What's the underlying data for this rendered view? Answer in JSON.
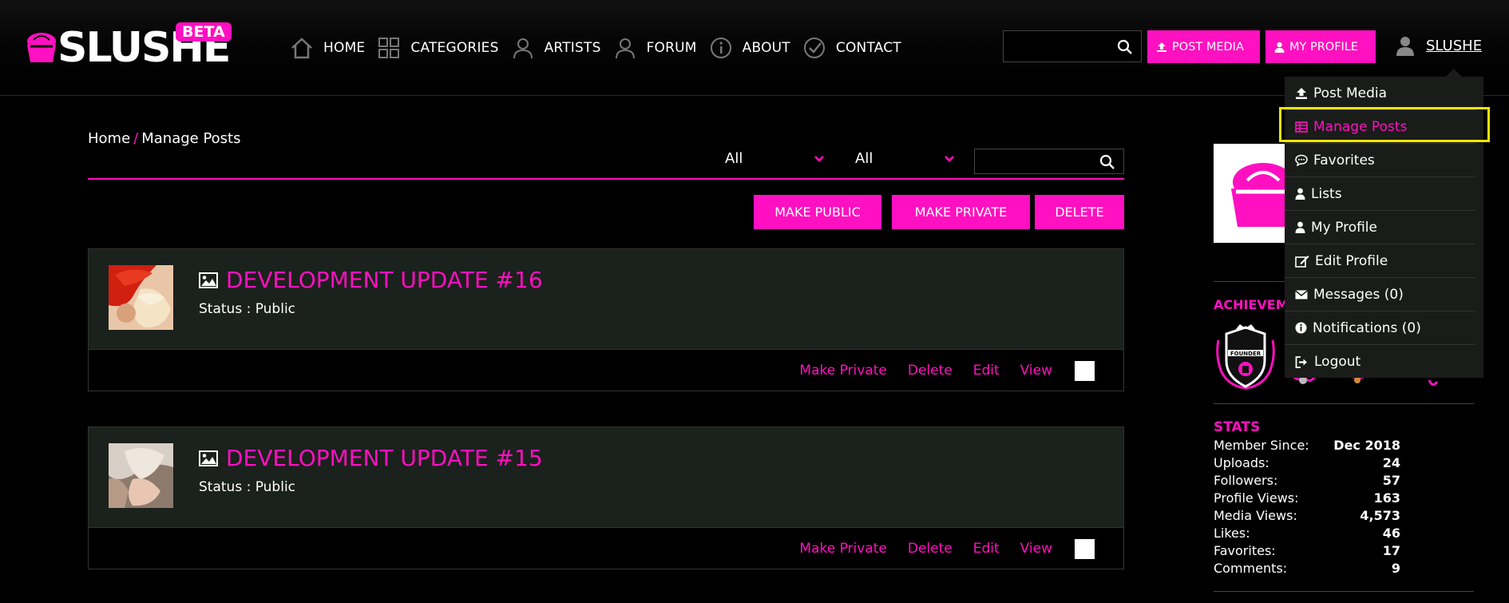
{
  "logo": {
    "text": "SLUSHE",
    "badge": "BETA"
  },
  "nav": [
    {
      "label": "HOME",
      "icon": "home-icon"
    },
    {
      "label": "CATEGORIES",
      "icon": "grid-icon"
    },
    {
      "label": "ARTISTS",
      "icon": "person-icon"
    },
    {
      "label": "FORUM",
      "icon": "person-icon"
    },
    {
      "label": "ABOUT",
      "icon": "info-icon"
    },
    {
      "label": "CONTACT",
      "icon": "check-icon"
    }
  ],
  "header": {
    "search_placeholder": "",
    "post_media_label": "POST MEDIA",
    "my_profile_label": "MY PROFILE",
    "username": "SLUSHE"
  },
  "dropdown": {
    "items": [
      {
        "label": "Post Media",
        "icon": "upload-icon"
      },
      {
        "label": "Manage Posts",
        "icon": "table-icon",
        "active": true
      },
      {
        "label": "Favorites",
        "icon": "comment-icon"
      },
      {
        "label": "Lists",
        "icon": "person-icon"
      },
      {
        "label": "My Profile",
        "icon": "person-icon"
      },
      {
        "label": "Edit Profile",
        "icon": "edit-icon"
      },
      {
        "label": "Messages (0)",
        "icon": "envelope-icon"
      },
      {
        "label": "Notifications (0)",
        "icon": "info-icon"
      },
      {
        "label": "Logout",
        "icon": "logout-icon"
      }
    ]
  },
  "breadcrumb": {
    "home": "Home",
    "separator": "/",
    "current": "Manage Posts"
  },
  "filters": {
    "type_value": "All",
    "status_value": "All",
    "search_placeholder": ""
  },
  "bulk_actions": {
    "make_public": "MAKE PUBLIC",
    "make_private": "MAKE PRIVATE",
    "delete": "DELETE"
  },
  "posts": [
    {
      "title": "DEVELOPMENT UPDATE #16",
      "status": "Status : Public",
      "actions": {
        "make_private": "Make Private",
        "delete": "Delete",
        "edit": "Edit",
        "view": "View"
      }
    },
    {
      "title": "DEVELOPMENT UPDATE #15",
      "status": "Status : Public",
      "actions": {
        "make_private": "Make Private",
        "delete": "Delete",
        "edit": "Edit",
        "view": "View"
      }
    }
  ],
  "sidebar": {
    "achievements_title": "ACHIEVEM",
    "badge_text": "FOUNDER",
    "stats_title": "STATS",
    "stats": [
      {
        "label": "Member Since:",
        "value": "Dec 2018"
      },
      {
        "label": "Uploads:",
        "value": "24"
      },
      {
        "label": "Followers:",
        "value": "57"
      },
      {
        "label": "Profile Views:",
        "value": "163"
      },
      {
        "label": "Media Views:",
        "value": "4,573"
      },
      {
        "label": "Likes:",
        "value": "46"
      },
      {
        "label": "Favorites:",
        "value": "17"
      },
      {
        "label": "Comments:",
        "value": "9"
      }
    ]
  },
  "colors": {
    "accent": "#ff10c0",
    "highlight": "#f5e400",
    "card": "#1b211c"
  }
}
